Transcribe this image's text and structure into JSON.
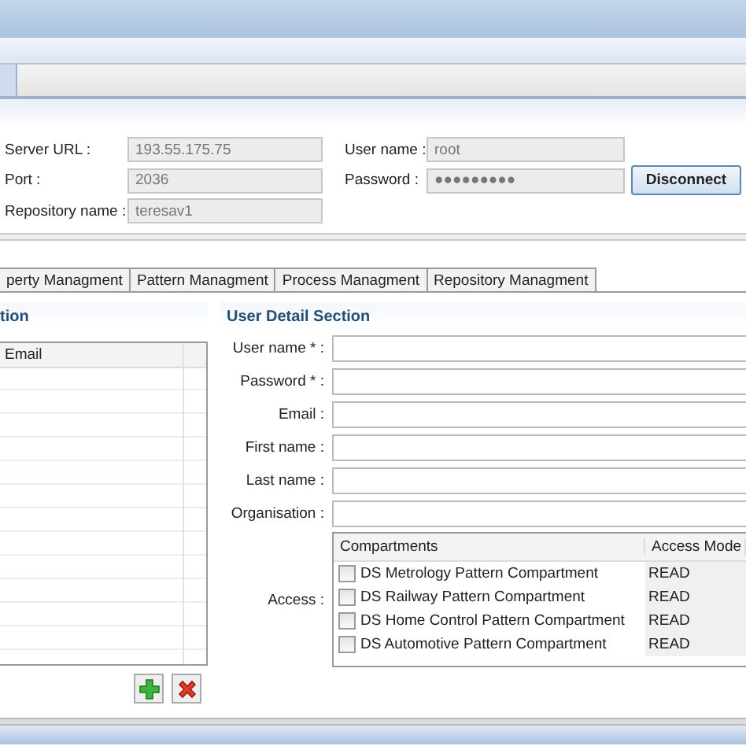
{
  "connection": {
    "fields": [
      {
        "label": "Server URL :",
        "value": "193.55.175.75"
      },
      {
        "label": "User name :",
        "value": "root"
      },
      {
        "label": "Port :",
        "value": "2036"
      },
      {
        "label": "Password :",
        "value": "●●●●●●●●●"
      },
      {
        "label": "Repository name :",
        "value": "teresav1"
      }
    ],
    "button": "Disconnect"
  },
  "tabs": [
    {
      "label": "perty Managment",
      "selected": false
    },
    {
      "label": "Pattern Managment",
      "selected": false
    },
    {
      "label": "Process Managment",
      "selected": false
    },
    {
      "label": "Repository Managment",
      "selected": false
    }
  ],
  "user_list": {
    "title": "tion",
    "columns": [
      "Email"
    ]
  },
  "user_detail": {
    "title": "User Detail Section",
    "fields": [
      {
        "label": "User name * :"
      },
      {
        "label": "Password * :"
      },
      {
        "label": "Email :"
      },
      {
        "label": "First name :"
      },
      {
        "label": "Last name :"
      },
      {
        "label": "Organisation :"
      }
    ],
    "access_label": "Access :",
    "access_table": {
      "columns": [
        "Compartments",
        "Access Mode"
      ],
      "rows": [
        {
          "name": "DS Metrology Pattern Compartment",
          "mode": "READ",
          "checked": false
        },
        {
          "name": "DS Railway Pattern Compartment",
          "mode": "READ",
          "checked": false
        },
        {
          "name": "DS Home Control Pattern Compartment",
          "mode": "READ",
          "checked": false
        },
        {
          "name": "DS Automotive Pattern Compartment",
          "mode": "READ",
          "checked": false
        }
      ]
    }
  }
}
